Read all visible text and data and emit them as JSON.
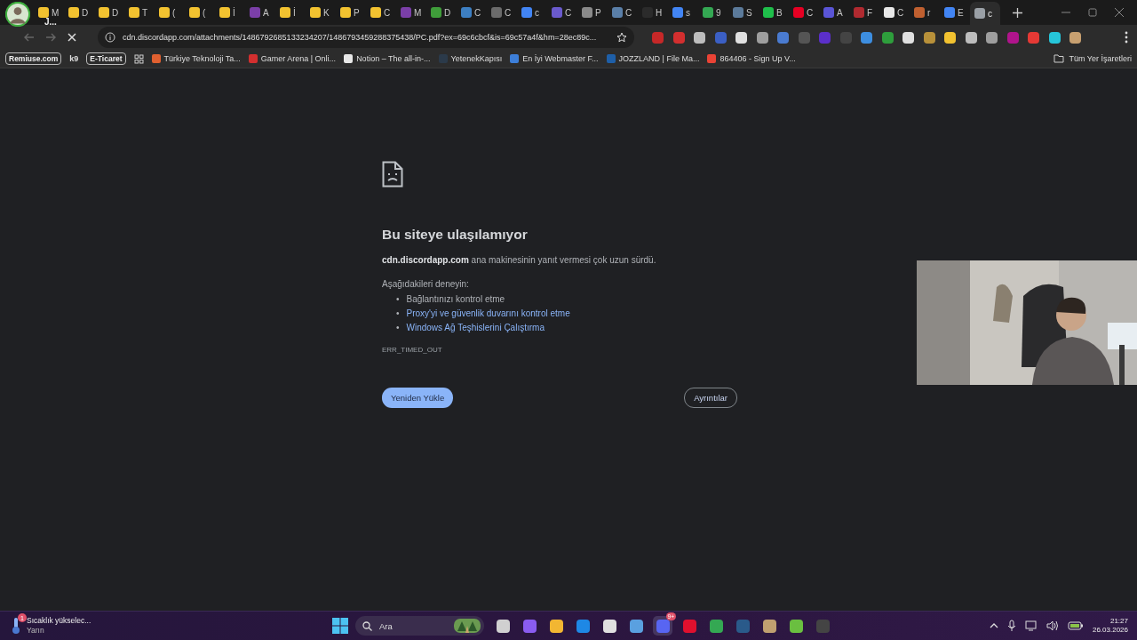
{
  "profile": {
    "label": "J..."
  },
  "tabs": [
    {
      "label": "M",
      "color": "#f2c230",
      "selected": false
    },
    {
      "label": "D",
      "color": "#f2c230",
      "selected": false
    },
    {
      "label": "D",
      "color": "#f2c230",
      "selected": false
    },
    {
      "label": "T",
      "color": "#f2c230",
      "selected": false
    },
    {
      "label": "(",
      "color": "#f2c230",
      "selected": false
    },
    {
      "label": "(",
      "color": "#f2c230",
      "selected": false
    },
    {
      "label": "İ",
      "color": "#f2c230",
      "selected": false
    },
    {
      "label": "A",
      "color": "#7b3fa8",
      "selected": false
    },
    {
      "label": "İ",
      "color": "#f2c230",
      "selected": false
    },
    {
      "label": "K",
      "color": "#f2c230",
      "selected": false
    },
    {
      "label": "P",
      "color": "#f2c230",
      "selected": false
    },
    {
      "label": "C",
      "color": "#f2c230",
      "selected": false
    },
    {
      "label": "M",
      "color": "#7b3fa8",
      "selected": false
    },
    {
      "label": "D",
      "color": "#3f9d3a",
      "selected": false
    },
    {
      "label": "C",
      "color": "#3d7fc2",
      "selected": false
    },
    {
      "label": "C",
      "color": "#6b6b6b",
      "selected": false
    },
    {
      "label": "c",
      "color": "#4285f4",
      "selected": false
    },
    {
      "label": "C",
      "color": "#6a5acd",
      "selected": false
    },
    {
      "label": "P",
      "color": "#8a8a8a",
      "selected": false
    },
    {
      "label": "C",
      "color": "#5a7fa8",
      "selected": false
    },
    {
      "label": "H",
      "color": "#2b2b2b",
      "selected": false
    },
    {
      "label": "s",
      "color": "#4285f4",
      "selected": false
    },
    {
      "label": "9",
      "color": "#34a853",
      "selected": false
    },
    {
      "label": "S",
      "color": "#5b7a9a",
      "selected": false
    },
    {
      "label": "B",
      "color": "#1fbf4b",
      "selected": false
    },
    {
      "label": "C",
      "color": "#e60023",
      "selected": false
    },
    {
      "label": "A",
      "color": "#5a55d6",
      "selected": false
    },
    {
      "label": "F",
      "color": "#b02a30",
      "selected": false
    },
    {
      "label": "C",
      "color": "#e8e8e8",
      "selected": false
    },
    {
      "label": "r",
      "color": "#c06030",
      "selected": false
    },
    {
      "label": "E",
      "color": "#4285f4",
      "selected": false
    },
    {
      "label": "c",
      "color": "#9aa0a6",
      "selected": true
    }
  ],
  "address_bar": {
    "url": "cdn.discordapp.com/attachments/1486792685133234207/1486793459288375438/PC.pdf?ex=69c6cbcf&is=69c57a4f&hm=28ec89c..."
  },
  "extensions": [
    {
      "color": "#c62828"
    },
    {
      "color": "#d32f2f"
    },
    {
      "color": "#bdbdbd"
    },
    {
      "color": "#3b5fc4"
    },
    {
      "color": "#e0e0e0"
    },
    {
      "color": "#9e9e9e"
    },
    {
      "color": "#4a7bd0"
    },
    {
      "color": "#555555"
    },
    {
      "color": "#5b2fc9"
    },
    {
      "color": "#444444"
    },
    {
      "color": "#3d8ee0"
    },
    {
      "color": "#2e9e3c"
    },
    {
      "color": "#e0e0e0"
    },
    {
      "color": "#b8913a"
    },
    {
      "color": "#f2c230"
    },
    {
      "color": "#bdbdbd"
    },
    {
      "color": "#9e9e9e"
    },
    {
      "color": "#b0148c"
    },
    {
      "color": "#e53935"
    },
    {
      "color": "#26c6da"
    },
    {
      "color": "#c8a070"
    }
  ],
  "bookmarks": [
    {
      "label": "Remiuse.com",
      "kind": "chip"
    },
    {
      "label": "k9",
      "kind": "plain"
    },
    {
      "label": "E-Ticaret",
      "kind": "chip"
    },
    {
      "label": "Türkiye Teknoloji Ta...",
      "kind": "link",
      "color": "#e06030"
    },
    {
      "label": "Gamer Arena | Onli...",
      "kind": "link",
      "color": "#d32f2f"
    },
    {
      "label": "Notion – The all-in-...",
      "kind": "link",
      "color": "#e8e8e8"
    },
    {
      "label": "YetenekKapısı",
      "kind": "link",
      "color": "#2b3a4a"
    },
    {
      "label": "En İyi Webmaster F...",
      "kind": "link",
      "color": "#3d7fd9"
    },
    {
      "label": "JOZZLAND | File Ma...",
      "kind": "link",
      "color": "#1e5fa8"
    },
    {
      "label": "864406 - Sign Up V...",
      "kind": "link",
      "color": "#ea4335"
    }
  ],
  "all_bookmarks": {
    "label": "Tüm Yer İşaretleri"
  },
  "error": {
    "title": "Bu siteye ulaşılamıyor",
    "message": "**cdn.discordapp.com** ana makinesinin yanıt vermesi çok uzun sürdü.",
    "suggestions_heading": "Aşağıdakileri deneyin:",
    "suggestions": [
      {
        "marker": "•",
        "text": "Bağlantınızı kontrol etme",
        "kind": "plain"
      },
      {
        "marker": "•",
        "text": "Proxy'yi ve güvenlik duvarını kontrol etme",
        "kind": "link"
      },
      {
        "marker": "•",
        "text": "Windows Ağ Teşhislerini Çalıştırma",
        "kind": "link"
      }
    ],
    "code": "ERR_TIMED_OUT",
    "reload_button": "Yeniden Yükle",
    "details_button": "Ayrıntılar"
  },
  "taskbar": {
    "weather": {
      "text": "Sıcaklık yükselec...",
      "subtext": "Yarın",
      "badge": "1"
    },
    "search": {
      "placeholder": "Ara"
    },
    "apps": [
      {
        "color": "#d0d0d0",
        "selected": false
      },
      {
        "color": "#8a5cf0",
        "selected": false
      },
      {
        "color": "#f2b632",
        "selected": false
      },
      {
        "color": "#1e88e5",
        "selected": false
      },
      {
        "color": "#e0e0e0",
        "selected": false
      },
      {
        "color": "#5aa0e0",
        "selected": false
      },
      {
        "color": "#5865f2",
        "selected": true,
        "badge": "9+"
      },
      {
        "color": "#e0102e",
        "selected": false
      },
      {
        "color": "#34a853",
        "selected": false
      },
      {
        "color": "#2a5a8a",
        "selected": false
      },
      {
        "color": "#c0a070",
        "selected": false
      },
      {
        "color": "#6abf40",
        "selected": false
      },
      {
        "color": "#444444",
        "selected": false
      }
    ],
    "time": "21:27",
    "date": "26.03.2026"
  }
}
